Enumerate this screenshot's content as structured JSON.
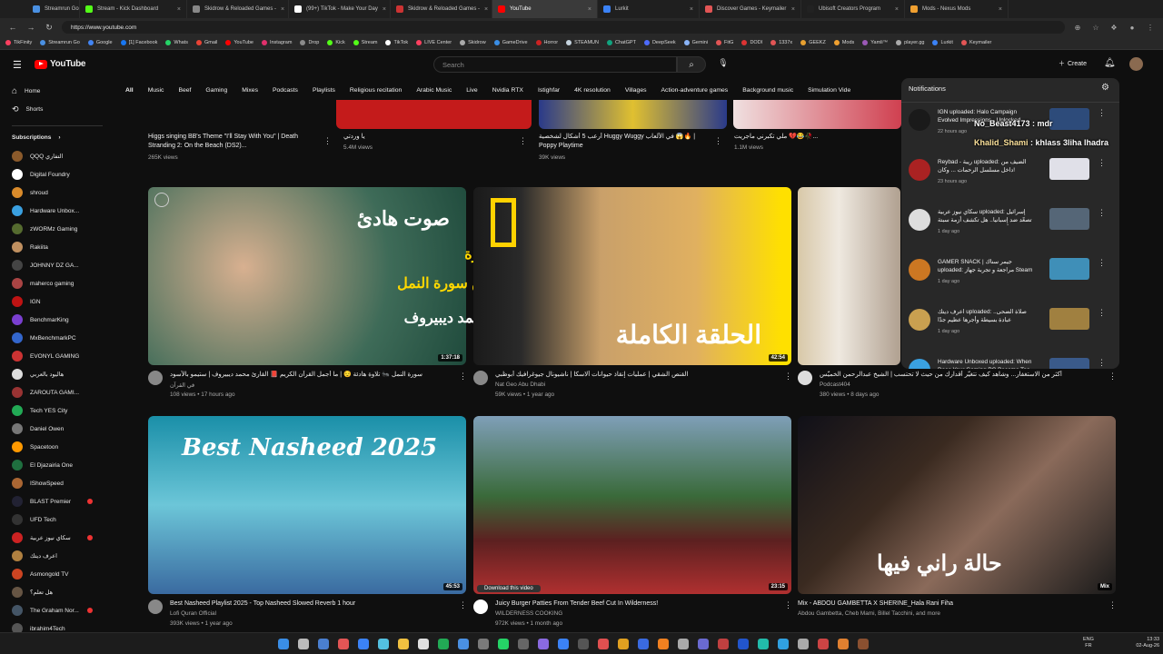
{
  "tabs": [
    {
      "label": "Streamrun Go",
      "color": "#4a90e2",
      "active": false
    },
    {
      "label": "Stream - Kick Dashboard",
      "color": "#53fc18",
      "active": false
    },
    {
      "label": "Skidrow & Reloaded Games -",
      "color": "#888888",
      "active": false
    },
    {
      "label": "(99+) TikTok - Make Your Day",
      "color": "#ffffff",
      "active": false
    },
    {
      "label": "Skidrow & Reloaded Games -",
      "color": "#cc3333",
      "active": false
    },
    {
      "label": "YouTube",
      "color": "#ff0000",
      "active": true
    },
    {
      "label": "Lurkit",
      "color": "#3b82f6",
      "active": false
    },
    {
      "label": "Discover Games - Keymailer",
      "color": "#e25555",
      "active": false
    },
    {
      "label": "Ubisoft Creators Program",
      "color": "#222222",
      "active": false
    },
    {
      "label": "Mods - Nexus Mods",
      "color": "#f0a030",
      "active": false
    }
  ],
  "address": {
    "url": "https://www.youtube.com"
  },
  "bookmarks": [
    {
      "label": "TikFinity",
      "color": "#ff4060"
    },
    {
      "label": "Streamrun Go",
      "color": "#4a90e2"
    },
    {
      "label": "Google",
      "color": "#4285f4"
    },
    {
      "label": "[1] Facebook",
      "color": "#1877f2"
    },
    {
      "label": "Whats",
      "color": "#25d366"
    },
    {
      "label": "Gmail",
      "color": "#ea4335"
    },
    {
      "label": "YouTube",
      "color": "#ff0000"
    },
    {
      "label": "Instagram",
      "color": "#e1306c"
    },
    {
      "label": "Drop",
      "color": "#8a8a8a"
    },
    {
      "label": "Kick",
      "color": "#53fc18"
    },
    {
      "label": "Stream",
      "color": "#53fc18"
    },
    {
      "label": "TikTok",
      "color": "#ffffff"
    },
    {
      "label": "LIVE Center",
      "color": "#ff4060"
    },
    {
      "label": "Skidrow",
      "color": "#aaaaaa"
    },
    {
      "label": "GameDrive",
      "color": "#3a8ee6"
    },
    {
      "label": "Horror",
      "color": "#cc2222"
    },
    {
      "label": "STEAMUN",
      "color": "#c6d4df"
    },
    {
      "label": "ChatGPT",
      "color": "#10a37f"
    },
    {
      "label": "DeepSeek",
      "color": "#4d6bfe"
    },
    {
      "label": "Gemini",
      "color": "#8ab4f8"
    },
    {
      "label": "FitG",
      "color": "#e25555"
    },
    {
      "label": "DODI",
      "color": "#dd3333"
    },
    {
      "label": "1337x",
      "color": "#e25555"
    },
    {
      "label": "GEEKZ",
      "color": "#e8a030"
    },
    {
      "label": "Mods",
      "color": "#f0a030"
    },
    {
      "label": "Yamli™",
      "color": "#9b59b6"
    },
    {
      "label": "player.gg",
      "color": "#aaaaaa"
    },
    {
      "label": "Lurkit",
      "color": "#3b82f6"
    },
    {
      "label": "Keymailer",
      "color": "#e25555"
    }
  ],
  "header": {
    "logo": "YouTube",
    "search_placeholder": "Search",
    "create": "Create"
  },
  "chips": [
    "All",
    "Music",
    "Beef",
    "Gaming",
    "Mixes",
    "Podcasts",
    "Playlists",
    "Religious recitation",
    "Arabic Music",
    "Live",
    "Nvidia RTX",
    "Istighfar",
    "4K resolution",
    "Villages",
    "Action-adventure games",
    "Background music",
    "Simulation Vide"
  ],
  "sidebar": {
    "home": "Home",
    "shorts": "Shorts",
    "subscriptions_title": "Subscriptions",
    "subs": [
      {
        "name": "QQQ التفاري",
        "color": "#8b5a2b",
        "live": false
      },
      {
        "name": "Digital Foundry",
        "color": "#ffffff",
        "live": false
      },
      {
        "name": "shroud",
        "color": "#d98b2b",
        "live": false
      },
      {
        "name": "Hardware Unbox...",
        "color": "#3aa0e0",
        "live": false
      },
      {
        "name": "zWORMz Gaming",
        "color": "#556b2f",
        "live": false
      },
      {
        "name": "Rakiita",
        "color": "#c09060",
        "live": false
      },
      {
        "name": "JOHNNY DZ GA...",
        "color": "#444444",
        "live": false
      },
      {
        "name": "maherco gaming",
        "color": "#aa4444",
        "live": false
      },
      {
        "name": "IGN",
        "color": "#bf1313",
        "live": false
      },
      {
        "name": "BenchmarKing",
        "color": "#7a3fd0",
        "live": false
      },
      {
        "name": "MxBenchmarkPC",
        "color": "#3366cc",
        "live": false
      },
      {
        "name": "EVONYL GAMING",
        "color": "#cc3333",
        "live": false
      },
      {
        "name": "هاليود بالعربي",
        "color": "#dddddd",
        "live": false
      },
      {
        "name": "ZAROUTA GAMI...",
        "color": "#993333",
        "live": false
      },
      {
        "name": "Tech YES City",
        "color": "#22aa55",
        "live": false
      },
      {
        "name": "Daniel Owen",
        "color": "#777777",
        "live": false
      },
      {
        "name": "Spacetoon",
        "color": "#ff9900",
        "live": false
      },
      {
        "name": "El Djazairia One",
        "color": "#1f6f3f",
        "live": false
      },
      {
        "name": "IShowSpeed",
        "color": "#aa6633",
        "live": false
      },
      {
        "name": "BLAST Premier",
        "color": "#222233",
        "live": true
      },
      {
        "name": "UFD Tech",
        "color": "#333333",
        "live": false
      },
      {
        "name": "سكاي نيوز عربية",
        "color": "#cc2222",
        "live": true
      },
      {
        "name": "اعرف ديتك",
        "color": "#b08040",
        "live": false
      },
      {
        "name": "Asmongold TV",
        "color": "#cc4422",
        "live": false
      },
      {
        "name": "هل تعلم؟",
        "color": "#665544",
        "live": false
      },
      {
        "name": "The Graham Nor...",
        "color": "#445566",
        "live": true
      },
      {
        "name": "ibrahim4Tech",
        "color": "#555555",
        "live": false
      }
    ]
  },
  "top_row": [
    {
      "title": "Higgs singing BB's Theme \"I'll Stay With You\" | Death Stranding 2: On the Beach (DS2)...",
      "meta": "265K views"
    },
    {
      "title": "يا وردتي",
      "meta": "5.4M views"
    },
    {
      "title": "أرعب 5 أشكال لشخصية Huggy Wuggy في الألعاب 😱🔥 | Poppy Playtime",
      "meta": "39K views"
    },
    {
      "title": "ملي تكبرني ماجريت 💔😂🥀...",
      "meta": "1.1M views"
    }
  ],
  "videos": [
    {
      "title": "سورة النمل 🐜 تلاوة هادئة 😌 | ما أجمل القرآن الكريم 📕 القارئ محمد ديبيروف | ستيمو بالأسود",
      "channel": "في القرآن",
      "meta": "108 views • 17 hours ago",
      "duration": "1:37:18",
      "thumb_text": [
        "صوت هادئ",
        "لأول مرة",
        "من سورة النمل",
        "محمد ديبيروف"
      ]
    },
    {
      "title": "القنص الشقي | عمليات إنقاذ حيوانات ألاسكا | ناشيونال جيوغرافيك أبوظبي",
      "channel": "Nat Geo Abu Dhabi",
      "meta": "59K views • 1 year ago",
      "duration": "42:54",
      "thumb_text": [
        "الحلقة الكاملة"
      ]
    },
    {
      "title": "أكثر من الاستغفار... وشاهد كيف تتغيّر أقدارك من حيث لا تحتسب | الشيخ عبدالرحمن الخميّس",
      "channel": "Podcast404",
      "meta": "380 views • 8 days ago",
      "duration": "",
      "thumb_text": []
    },
    {
      "title": "Best Nasheed Playlist 2025 - Top Nasheed Slowed Reverb 1 hour",
      "channel": "Lofi Quran Official",
      "meta": "393K views • 1 year ago",
      "duration": "45:53",
      "thumb_text": [
        "Best Nasheed 2025"
      ]
    },
    {
      "title": "Juicy Burger Patties From Tender Beef Cut In Wilderness!",
      "channel": "WILDERNESS COOKING",
      "meta": "972K views • 1 month ago",
      "duration": "23:15",
      "thumb_text": [
        "Download this video"
      ]
    },
    {
      "title": "Mix - ABDOU GAMBETTA X SHERINE_Hala Rani Fiha",
      "channel": "Abdou Gambetta, Cheb Mami, Billel Tacchini, and more",
      "meta": "",
      "duration": "Mix",
      "thumb_text": [
        "حالة راني فيها"
      ]
    }
  ],
  "notifications": {
    "title": "Notifications",
    "items": [
      {
        "text": "IGN uploaded: Halo Campaign Evolved Impressions - Unlocked Size...",
        "time": "22 hours ago",
        "avatar": "#1a1a1a",
        "thumb": "#2d4b7a"
      },
      {
        "text": "Reybad - ريبة uploaded: الضيف من داخل مسلسل الرحمات ... وكان!",
        "time": "23 hours ago",
        "avatar": "#aa2222",
        "thumb": "#e0e0e8"
      },
      {
        "text": "سكاي نيوز عربية uploaded: إسرائيل تصعّد ضد إسبانيا.. هل تكشف أزمة سبتة انقسام أوروبا حول الهجرة؟ | #ظفورة",
        "time": "1 day ago",
        "avatar": "#dddddd",
        "thumb": "#556677"
      },
      {
        "text": "GAMER SNACK | جيمر سناك uploaded: مراجعة و تجربة جهاز Steam Machine سيم الجديد",
        "time": "1 day ago",
        "avatar": "#cc7722",
        "thumb": "#3f8fb8"
      },
      {
        "text": "اعرف ديتك uploaded: صلاة الضحى.. عبادة بسيطة وأجرها عظيم جدًا",
        "time": "1 day ago",
        "avatar": "#c9a050",
        "thumb": "#a08040"
      },
      {
        "text": "Hardware Unboxed uploaded: When Does Your Gaming PC Become Too...",
        "time": "",
        "avatar": "#3aa0e0",
        "thumb": "#3a5a8a"
      }
    ]
  },
  "overlay": {
    "line1": "No_Beast4173 : mdr",
    "line2_name": "Khalid_Shami",
    "line2_msg": ": khlass 3liha lhadra"
  },
  "system": {
    "lang1": "ENG",
    "lang2": "FR",
    "time": "13:33",
    "date": "02-Aug-26"
  }
}
